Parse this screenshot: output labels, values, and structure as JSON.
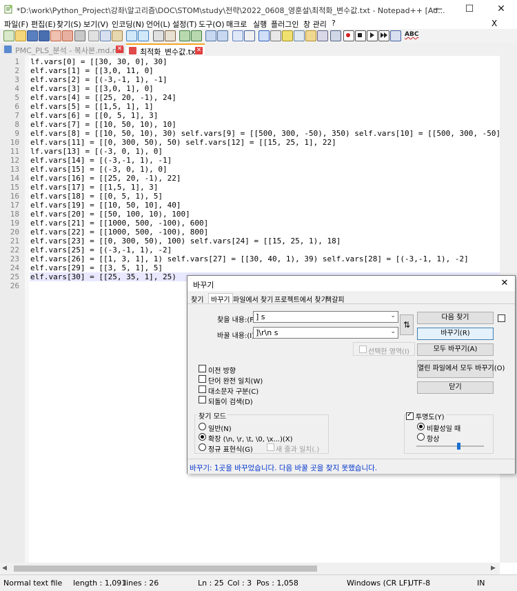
{
  "window": {
    "title": "*D:\\work\\Python_Project\\강좌\\알고리즘\\DOC\\STOM\\study\\전략\\2022_0608_영훈설\\최적화_변수값.txt - Notepad++ [Ad...",
    "minimize": "—",
    "maximize": "☐",
    "close": "✕"
  },
  "menu": {
    "items": [
      "파일(F)",
      "편집(E)",
      "찾기(S)",
      "보기(V)",
      "인코딩(N)",
      "언어(L)",
      "설정(T)",
      "도구(O)",
      "매크로",
      "실행",
      "플러그인",
      "창 관리",
      "?"
    ],
    "close_doc": "X"
  },
  "toolbar": {
    "icons": [
      "new-file-icon",
      "open-file-icon",
      "save-icon",
      "save-all-icon",
      "close-icon",
      "close-all-icon",
      "print-icon",
      "cut-icon",
      "copy-icon",
      "paste-icon",
      "undo-icon",
      "redo-icon",
      "find-icon",
      "replace-icon",
      "zoom-in-icon",
      "zoom-out-icon",
      "sync-v-icon",
      "sync-h-icon",
      "word-wrap-icon",
      "show-all-chars-icon",
      "indent-guide-icon",
      "udl-icon",
      "doc-map-icon",
      "function-list-icon",
      "folder-workspace-icon",
      "monitor-icon",
      "record-macro-icon",
      "stop-macro-icon",
      "play-macro-icon",
      "run-macro-icon",
      "save-macro-icon",
      "spellcheck-icon"
    ],
    "spellcheck_text": "ABC"
  },
  "tabs": [
    {
      "label": "PMC_PLS_분석 - 복사본.md.md",
      "active": false
    },
    {
      "label": "최적화_변수값.txt",
      "active": true
    }
  ],
  "editor": {
    "lines": [
      "lf.vars[0] = [[30, 30, 0], 30]",
      "elf.vars[1] = [[3,0, 11, 0]",
      "elf.vars[2] = [(-3,-1, 1), -1]",
      "elf.vars[3] = [[3,0, 1], 0]",
      "elf.vars[4] = [[25, 20, -1), 24]",
      "elf.vars[5] = [[1,5, 1], 1]",
      "elf.vars[6] = [[0, 5, 1], 3]",
      "elf.vars[7] = [[10, 50, 10), 10]",
      "elf.vars[8] = [[10, 50, 10), 30) self.vars[9] = [[500, 300, -50), 350) self.vars[10] = [[500, 300, -50]",
      "elf.vars[11] = [[0, 300, 50), 50) self.vars[12] = [[15, 25, 1], 22]",
      "lf.vars[13] = [(-3, 0, 1), 0]",
      "elf.vars[14] = [(-3,-1, 1), -1]",
      "elf.vars[15] = [(-3, 0, 1), 0]",
      "elf.vars[16] = [[25, 20, -1), 22]",
      "elf.vars[17] = [[1,5, 1], 3]",
      "elf.vars[18] = [[0, 5, 1), 5]",
      "elf.vars[19] = [[10, 50, 10], 40]",
      "elf.vars[20] = [[50, 100, 10), 100]",
      "elf.vars[21] = [[1000, 500, -100), 600]",
      "elf.vars[22] = [[1000, 500, -100), 800]",
      "elf.vars[23] = [[0, 300, 50), 100) self.vars[24] = [[15, 25, 1), 18]",
      "elf.vars[25] = [(-3,-1, 1), -2]",
      "elf.vars[26] = [[1, 3, 1], 1) self.vars[27] = [[30, 40, 1), 39) self.vars[28] = [(-3,-1, 1), -2]",
      "elf.vars[29] = [[3, 5, 1], 5]",
      "elf.vars[30] = [[25, 35, 1], 25)",
      ""
    ],
    "current_line": 25
  },
  "status": {
    "file_type": "Normal text file",
    "length": "length : 1,091",
    "lines": "lines : 26",
    "ln": "Ln : 25",
    "col": "Col : 3",
    "pos": "Pos : 1,058",
    "eol": "Windows (CR LF)",
    "encoding": "UTF-8",
    "mode": "IN"
  },
  "dialog": {
    "title": "바꾸기",
    "close": "✕",
    "tabs": [
      "찾기",
      "바꾸기",
      "파일에서 찾기",
      "프로젝트에서 찾기",
      "책갈피"
    ],
    "active_tab": "바꾸기",
    "find_label": "찾을 내용:(F)",
    "find_value": "] s",
    "replace_label": "바꿀 내용:(I)",
    "replace_value": "]\\r\\n s",
    "swap_icon": "⇅",
    "buttons": {
      "find_next": "다음 찾기",
      "replace": "바꾸기(R)",
      "replace_all": "모두 바꾸기(A)",
      "replace_all_open": "열린 파일에서 모두 바꾸기(O)",
      "close": "닫기"
    },
    "in_selection": "선택한 영역(I)",
    "options": [
      {
        "label": "이전 방향",
        "checked": false
      },
      {
        "label": "단어 완전 일치(W)",
        "checked": false
      },
      {
        "label": "대소문자 구분(C)",
        "checked": false
      },
      {
        "label": "되돌이 검색(D)",
        "checked": false
      }
    ],
    "search_mode": {
      "title": "찾기 모드",
      "normal": "일반(N)",
      "extended": "확장 (\\n, \\r, \\t, \\0, \\x...)(X)",
      "regex": "정규 표현식(G)",
      "dot_newline": "새 줄과 일치(.)",
      "selected": "extended"
    },
    "transparency": {
      "title": "투명도(Y)",
      "checked": true,
      "on_losing_focus": "비활성일 때",
      "always": "항상",
      "selected": "on_losing_focus",
      "slider_level": 0.62
    },
    "status_message": "바꾸기: 1곳을 바꾸었습니다. 다음 바꿀 곳을 찾지 못했습니다.",
    "status_color": "#0033cc"
  },
  "colors": {
    "current_line": "#e8e8ff",
    "active_tab_accent": "#f5a623"
  }
}
